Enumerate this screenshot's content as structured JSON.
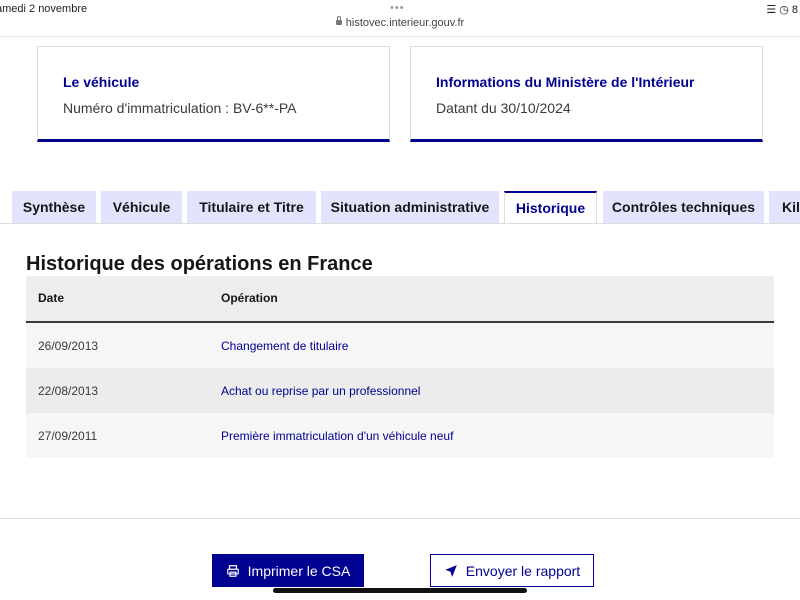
{
  "status_bar": {
    "time": "amedi 2 novembre",
    "url": "histovec.interieur.gouv.fr",
    "battery": "8"
  },
  "cards": [
    {
      "title": "Le véhicule",
      "text": "Numéro d'immatriculation : BV-6**-PA"
    },
    {
      "title": "Informations du Ministère de l'Intérieur",
      "text": "Datant du 30/10/2024"
    }
  ],
  "tabs": [
    {
      "label": "Synthèse"
    },
    {
      "label": "Véhicule"
    },
    {
      "label": "Titulaire et Titre"
    },
    {
      "label": "Situation administrative"
    },
    {
      "label": "Historique"
    },
    {
      "label": "Contrôles techniques"
    },
    {
      "label": "Kilo"
    }
  ],
  "active_tab": "Historique",
  "section": {
    "title": "Historique des opérations en France",
    "columns": [
      "Date",
      "Opération"
    ],
    "rows": [
      {
        "date": "26/09/2013",
        "operation": "Changement de titulaire"
      },
      {
        "date": "22/08/2013",
        "operation": "Achat ou reprise par un professionnel"
      },
      {
        "date": "27/09/2011",
        "operation": "Première immatriculation d'un véhicule neuf"
      }
    ]
  },
  "actions": {
    "print_label": "Imprimer le CSA",
    "send_label": "Envoyer le rapport"
  },
  "colors": {
    "primary": "#000091",
    "tab_bg": "#e3e3fd"
  }
}
